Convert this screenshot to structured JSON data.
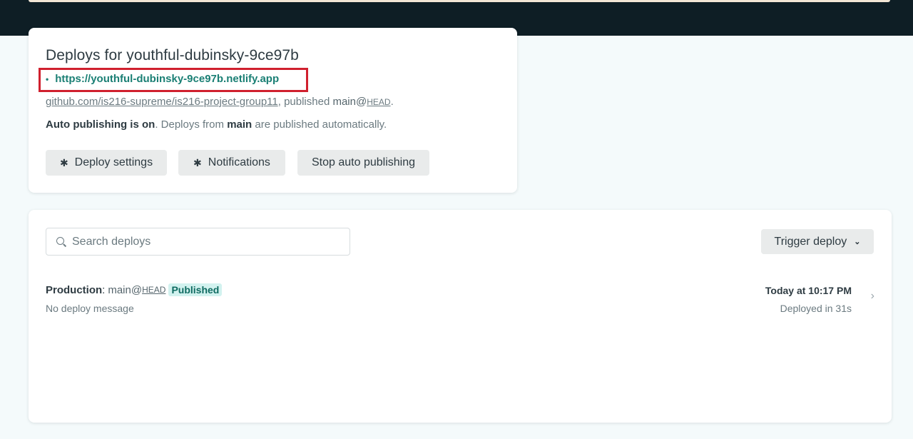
{
  "site": {
    "title": "Deploys for youthful-dubinsky-9ce97b",
    "url": "https://youthful-dubinsky-9ce97b.netlify.app",
    "repo": "github.com/is216-supreme/is216-project-group11",
    "published_prefix": ", published",
    "branch": "main@",
    "head": "HEAD",
    "period": "."
  },
  "autopublish": {
    "strong": "Auto publishing is on",
    "text1": ". Deploys from",
    "branch": "main",
    "text2": "are published automatically."
  },
  "buttons": {
    "deploy_settings": "Deploy settings",
    "notifications": "Notifications",
    "stop_auto_publishing": "Stop auto publishing",
    "trigger_deploy": "Trigger deploy"
  },
  "search": {
    "placeholder": "Search deploys"
  },
  "deploys": [
    {
      "context": "Production",
      "ref": "main@",
      "head": "HEAD",
      "status": "Published",
      "message": "No deploy message",
      "time": "Today at 10:17 PM",
      "duration": "Deployed in 31s"
    }
  ],
  "colors": {
    "accent": "#1a7f74",
    "highlight_box": "#d0202e",
    "badge_bg": "#d2f2ef",
    "header_dark": "#0e1e25"
  },
  "icons": [
    "gear-icon",
    "search-icon",
    "chevron-down-icon",
    "chevron-right-icon"
  ]
}
